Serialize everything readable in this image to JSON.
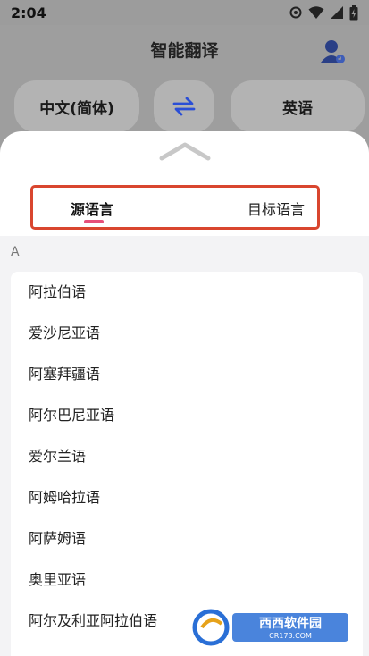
{
  "status_bar": {
    "time": "2:04"
  },
  "header": {
    "title": "智能翻译",
    "source_language": "中文(简体)",
    "target_language": "英语"
  },
  "picker": {
    "tabs": [
      {
        "label": "源语言",
        "active": true
      },
      {
        "label": "目标语言",
        "active": false
      }
    ],
    "section_letter": "A",
    "languages": [
      "阿拉伯语",
      "爱沙尼亚语",
      "阿塞拜疆语",
      "阿尔巴尼亚语",
      "爱尔兰语",
      "阿姆哈拉语",
      "阿萨姆语",
      "奥里亚语",
      "阿尔及利亚阿拉伯语"
    ]
  },
  "watermark": {
    "brand": "西西软件园",
    "url": "CR173.COM"
  },
  "colors": {
    "accent_underline": "#e6507a",
    "highlight_border": "#d9462f",
    "swap_icon": "#2b4fd6"
  }
}
